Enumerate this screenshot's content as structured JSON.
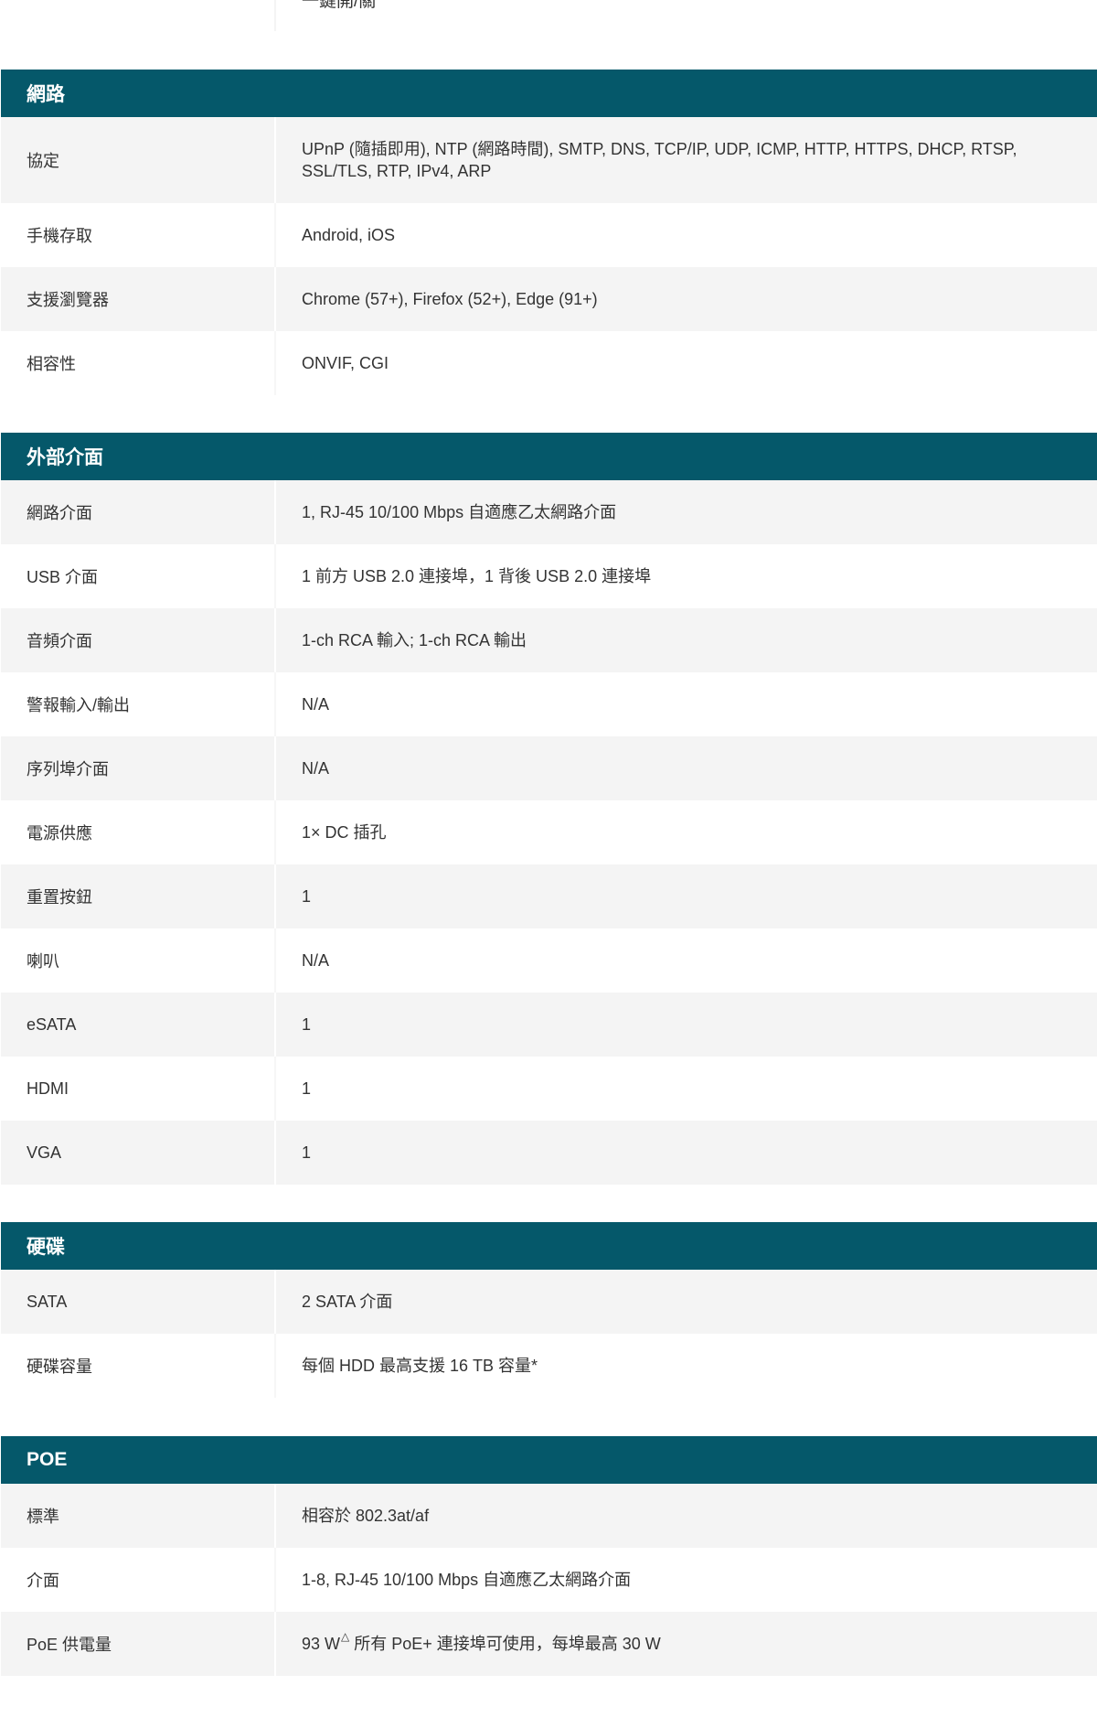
{
  "top_stub_text": "一鍵開/關",
  "sections": {
    "network": {
      "title": "網路",
      "rows": [
        {
          "label": "協定",
          "value": "UPnP (隨插即用), NTP (網路時間), SMTP, DNS, TCP/IP, UDP, ICMP, HTTP, HTTPS, DHCP, RTSP, SSL/TLS, RTP, IPv4, ARP"
        },
        {
          "label": "手機存取",
          "value": "Android, iOS"
        },
        {
          "label": "支援瀏覽器",
          "value": "Chrome (57+), Firefox (52+), Edge (91+)"
        },
        {
          "label": "相容性",
          "value": "ONVIF, CGI"
        }
      ]
    },
    "interfaces": {
      "title": "外部介面",
      "rows": [
        {
          "label": "網路介面",
          "value": "1, RJ-45 10/100 Mbps 自適應乙太網路介面"
        },
        {
          "label": "USB 介面",
          "value": "1 前方 USB 2.0 連接埠，1 背後 USB 2.0 連接埠"
        },
        {
          "label": "音頻介面",
          "value": "1-ch RCA 輸入; 1-ch RCA 輸出"
        },
        {
          "label": "警報輸入/輸出",
          "value": "N/A"
        },
        {
          "label": "序列埠介面",
          "value": "N/A"
        },
        {
          "label": "電源供應",
          "value": "1× DC 插孔"
        },
        {
          "label": "重置按鈕",
          "value": "1"
        },
        {
          "label": "喇叭",
          "value": "N/A"
        },
        {
          "label": "eSATA",
          "value": "1"
        },
        {
          "label": "HDMI",
          "value": "1"
        },
        {
          "label": "VGA",
          "value": "1"
        }
      ]
    },
    "hdd": {
      "title": "硬碟",
      "rows": [
        {
          "label": "SATA",
          "value": "2 SATA 介面"
        },
        {
          "label": "硬碟容量",
          "value": "每個 HDD 最高支援 16 TB 容量*"
        }
      ]
    },
    "poe": {
      "title": "POE",
      "rows": [
        {
          "label": "標準",
          "value": "相容於 802.3at/af"
        },
        {
          "label": "介面",
          "value": "1-8, RJ-45 10/100 Mbps 自適應乙太網路介面"
        },
        {
          "label": "PoE 供電量",
          "value_main": "93 W",
          "value_mark": "△",
          "value_rest": " 所有 PoE+ 連接埠可使用，每埠最高 30 W"
        }
      ]
    }
  },
  "colors": {
    "header_bg": "#05586a",
    "row_alt_bg": "#f4f4f4"
  }
}
